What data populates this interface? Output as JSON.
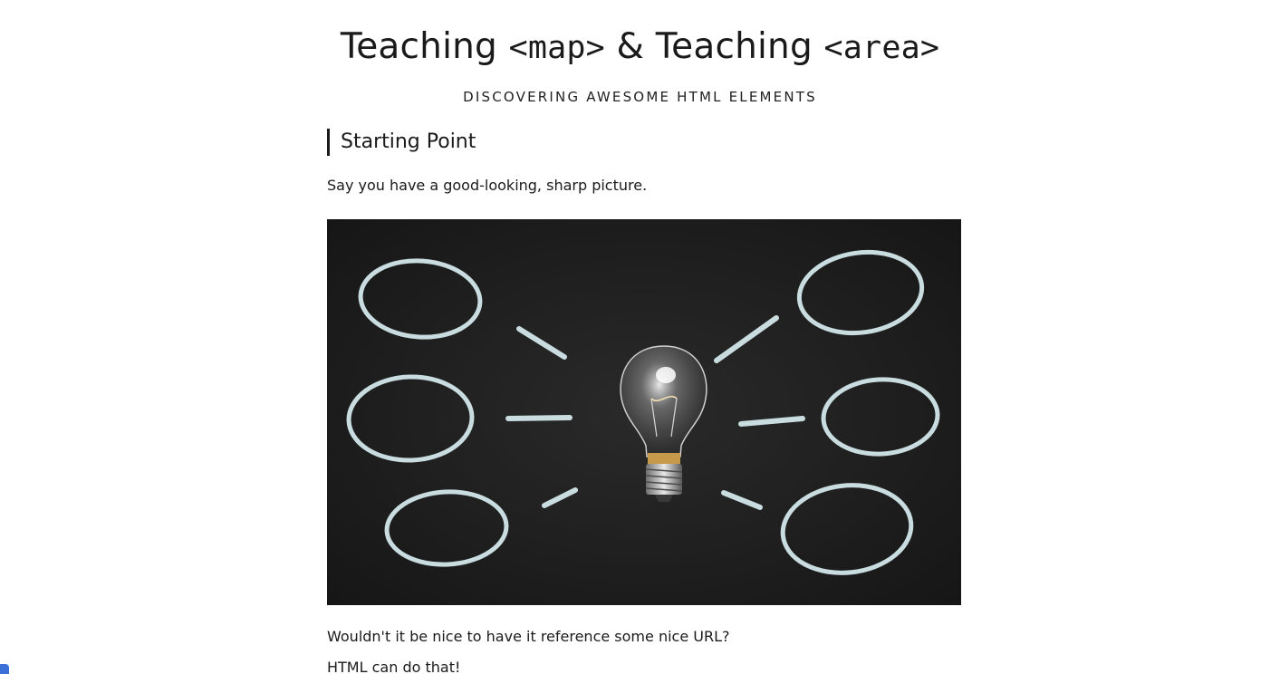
{
  "header": {
    "title_part1": "Teaching ",
    "title_code1": "<map>",
    "title_part2": " & Teaching ",
    "title_code2": "<area>",
    "subtitle": "DISCOVERING AWESOME HTML ELEMENTS"
  },
  "section": {
    "heading": "Starting Point",
    "intro": "Say you have a good-looking, sharp picture.",
    "question": "Wouldn't it be nice to have it reference some nice URL?",
    "answer": "HTML can do that!"
  },
  "colors": {
    "chalkboard": "#1f1f1f",
    "chalk": "#c9dde0",
    "accent_tab": "#3a6fd8"
  }
}
